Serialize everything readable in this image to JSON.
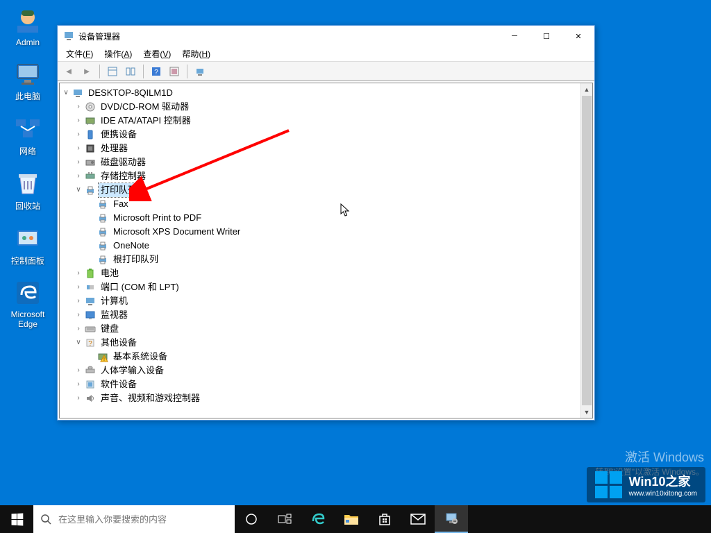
{
  "desktop": [
    {
      "name": "admin",
      "label": "Admin",
      "icon": "user"
    },
    {
      "name": "this-pc",
      "label": "此电脑",
      "icon": "pc"
    },
    {
      "name": "network",
      "label": "网络",
      "icon": "net"
    },
    {
      "name": "recycle",
      "label": "回收站",
      "icon": "bin"
    },
    {
      "name": "control-panel",
      "label": "控制面板",
      "icon": "cp"
    },
    {
      "name": "edge",
      "label": "Microsoft Edge",
      "icon": "edge"
    }
  ],
  "watermark": {
    "line1": "激活 Windows",
    "line2": "转到\"设置\"以激活 Windows。"
  },
  "brand": {
    "title": "Win10之家",
    "url": "www.win10xitong.com"
  },
  "taskbar": {
    "search_placeholder": "在这里输入你要搜索的内容",
    "icons": [
      {
        "name": "cortana",
        "glyph": "○"
      },
      {
        "name": "task-view",
        "glyph": "⧉"
      },
      {
        "name": "edge",
        "glyph": "e"
      },
      {
        "name": "explorer",
        "glyph": "📁"
      },
      {
        "name": "store",
        "glyph": "🛍"
      },
      {
        "name": "mail",
        "glyph": "✉"
      },
      {
        "name": "devmgr",
        "glyph": "🔧",
        "active": true
      }
    ]
  },
  "window": {
    "title": "设备管理器",
    "menu": [
      {
        "label": "文件",
        "key": "F"
      },
      {
        "label": "操作",
        "key": "A"
      },
      {
        "label": "查看",
        "key": "V"
      },
      {
        "label": "帮助",
        "key": "H"
      }
    ]
  },
  "tree": {
    "root": "DESKTOP-8QILM1D",
    "nodes": [
      {
        "label": "DVD/CD-ROM 驱动器",
        "icon": "💿",
        "exp": false
      },
      {
        "label": "IDE ATA/ATAPI 控制器",
        "icon": "ide",
        "exp": false
      },
      {
        "label": "便携设备",
        "icon": "📱",
        "exp": false
      },
      {
        "label": "处理器",
        "icon": "▣",
        "exp": false
      },
      {
        "label": "磁盘驱动器",
        "icon": "💽",
        "exp": false
      },
      {
        "label": "存储控制器",
        "icon": "sc",
        "exp": false
      },
      {
        "label": "打印队列",
        "icon": "🖨",
        "exp": true,
        "selected": true,
        "children": [
          {
            "label": "Fax",
            "icon": "🖨"
          },
          {
            "label": "Microsoft Print to PDF",
            "icon": "🖨"
          },
          {
            "label": "Microsoft XPS Document Writer",
            "icon": "🖨"
          },
          {
            "label": "OneNote",
            "icon": "🖨"
          },
          {
            "label": "根打印队列",
            "icon": "🖨"
          }
        ]
      },
      {
        "label": "电池",
        "icon": "🔋",
        "exp": false
      },
      {
        "label": "端口 (COM 和 LPT)",
        "icon": "⚟",
        "exp": false
      },
      {
        "label": "计算机",
        "icon": "🖥",
        "exp": false
      },
      {
        "label": "监视器",
        "icon": "🖵",
        "exp": false
      },
      {
        "label": "键盘",
        "icon": "⌨",
        "exp": false
      },
      {
        "label": "其他设备",
        "icon": "❓",
        "exp": true,
        "children": [
          {
            "label": "基本系统设备",
            "icon": "⚠"
          }
        ]
      },
      {
        "label": "人体学输入设备",
        "icon": "hid",
        "exp": false
      },
      {
        "label": "软件设备",
        "icon": "sw",
        "exp": false
      },
      {
        "label": "声音、视频和游戏控制器",
        "icon": "🔊",
        "exp": false
      }
    ]
  }
}
